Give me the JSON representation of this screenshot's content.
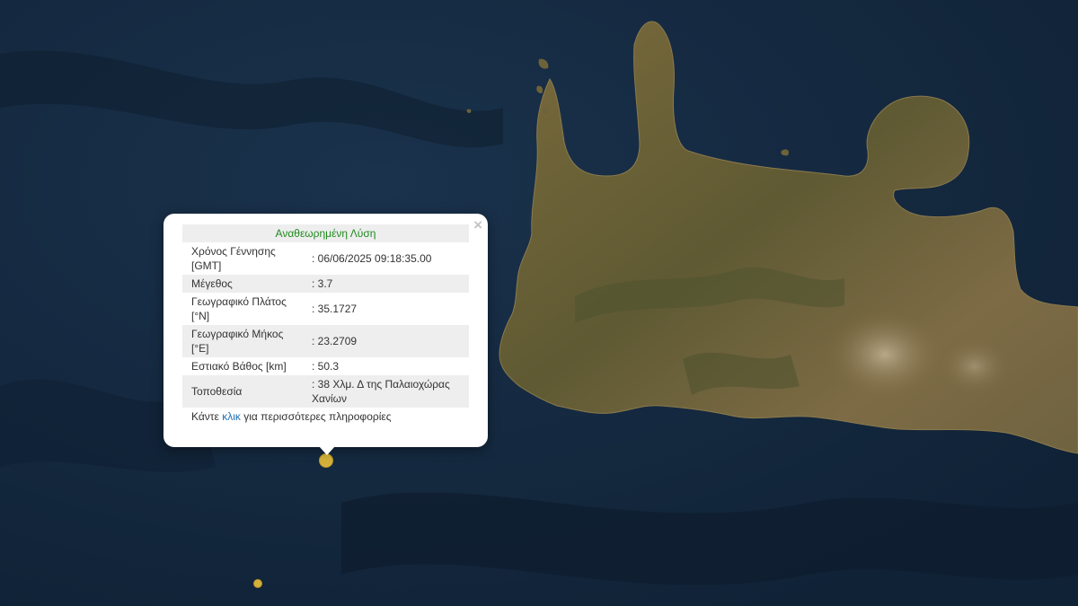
{
  "map": {
    "ocean_color": "#13283f",
    "land_color": "#6e6238",
    "marker_color": "#d4b13a"
  },
  "markers": [
    {
      "name": "epicenter-selected",
      "lat": 35.1727,
      "lon": 23.2709,
      "magnitude": 3.7
    },
    {
      "name": "earthquake-other",
      "magnitude": null
    }
  ],
  "popup": {
    "title": "Αναθεωρημένη Λύση",
    "close_symbol": "×",
    "rows": [
      {
        "label": "Χρόνος Γέννησης [GMT]",
        "value": ": 06/06/2025 09:18:35.00"
      },
      {
        "label": "Μέγεθος",
        "value": ": 3.7"
      },
      {
        "label": "Γεωγραφικό Πλάτος [°N]",
        "value": ": 35.1727"
      },
      {
        "label": "Γεωγραφικό Μήκος [°E]",
        "value": ": 23.2709"
      },
      {
        "label": "Εστιακό Βάθος [km]",
        "value": ": 50.3"
      },
      {
        "label": "Τοποθεσία",
        "value": ": 38 Χλμ. Δ της Παλαιοχώρας Χανίων"
      }
    ],
    "footer": {
      "prefix": "Κάντε ",
      "link": "κλικ",
      "suffix": " για περισσότερες πληροφορίες"
    }
  }
}
